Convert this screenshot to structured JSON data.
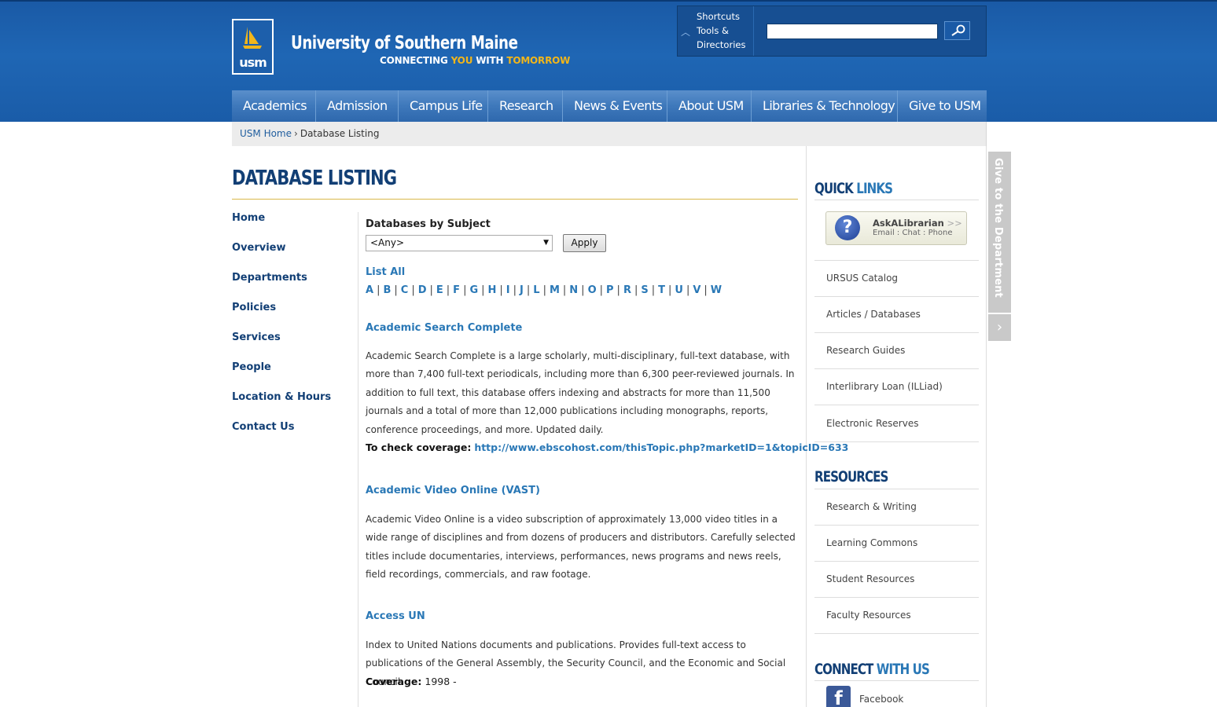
{
  "header": {
    "logo_text": "usm",
    "university_name": "University of Southern Maine",
    "tagline_parts": [
      "CONNECTING ",
      "YOU",
      " WITH ",
      "TOMORROW"
    ],
    "shortcuts": [
      "Shortcuts",
      "Tools &",
      "Directories"
    ],
    "search": {
      "value": "",
      "placeholder": ""
    }
  },
  "nav": [
    "Academics",
    "Admission",
    "Campus Life",
    "Research",
    "News & Events",
    "About USM",
    "Libraries & Technology",
    "Give to USM"
  ],
  "breadcrumb": {
    "home": "USM Home",
    "separator": "›",
    "current": "Database Listing"
  },
  "page_title": "DATABASE LISTING",
  "left_nav": [
    "Home",
    "Overview",
    "Departments",
    "Policies",
    "Services",
    "People",
    "Location & Hours",
    "Contact Us"
  ],
  "filter": {
    "label": "Databases by Subject",
    "selected": "<Any>",
    "apply_label": "Apply",
    "list_all": "List All",
    "letters": [
      "A",
      "B",
      "C",
      "D",
      "E",
      "F",
      "G",
      "H",
      "I",
      "J",
      "L",
      "M",
      "N",
      "O",
      "P",
      "R",
      "S",
      "T",
      "U",
      "V",
      "W"
    ]
  },
  "databases": [
    {
      "title": "Academic Search Complete",
      "description": "Academic Search Complete is a large scholarly, multi-disciplinary, full-text database, with more than 7,400 full-text periodicals, including more than 6,300 peer-reviewed journals. In addition to full text, this database offers indexing and abstracts for more than 11,500 journals and a total of more than 12,000 publications including monographs, reports, conference proceedings, and more. Updated daily.",
      "extra_label": "To check coverage:",
      "extra_link": "http://www.ebscohost.com/thisTopic.php?marketID=1&topicID=633"
    },
    {
      "title": "Academic Video Online (VAST)",
      "description": "Academic Video Online is a video subscription of approximately 13,000 video titles in a wide range of disciplines and from dozens of producers and distributors. Carefully selected titles include documentaries, interviews, performances, news programs and news reels, field recordings, commercials, and raw footage."
    },
    {
      "title": "Access UN",
      "description": "Index to United Nations documents and publications. Provides full-text access to publications of the General Assembly, the Security Council, and the Economic and Social Council.",
      "extra_label": "Coverage:",
      "extra_value": " 1998 -"
    }
  ],
  "quick_links": {
    "title_a": "QUICK",
    "title_b": " LINKS",
    "ask": {
      "title": "AskALibrarian",
      "chevrons": " >>",
      "sub": "Email : Chat : Phone"
    },
    "items": [
      "URSUS Catalog",
      "Articles / Databases",
      "Research Guides",
      "Interlibrary Loan (ILLiad)",
      "Electronic Reserves"
    ]
  },
  "resources": {
    "title": "RESOURCES",
    "items": [
      "Research & Writing",
      "Learning Commons",
      "Student Resources",
      "Faculty Resources"
    ]
  },
  "connect": {
    "title_a": "CONNECT",
    "title_b": " WITH US",
    "facebook": "Facebook"
  },
  "give_tab": {
    "label": "Give to the Department",
    "arrow": "›"
  },
  "colors": {
    "header_blue": "#1f66b4",
    "title_navy": "#123f75",
    "link_blue": "#2a78b6",
    "tagline_gold": "#f2b61a"
  }
}
